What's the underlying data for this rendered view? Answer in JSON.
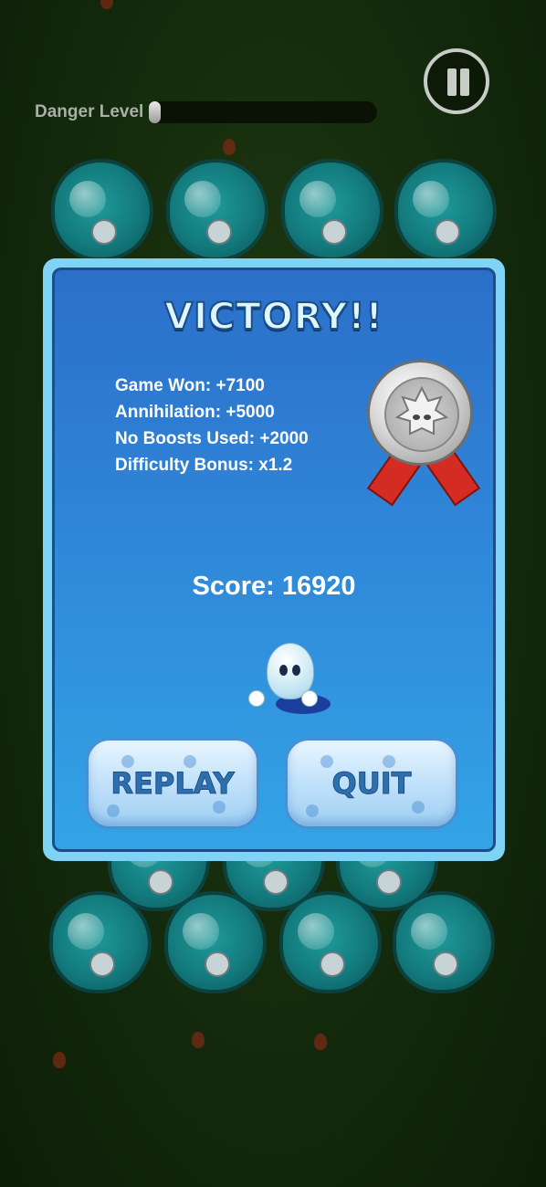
{
  "hud": {
    "danger_label": "Danger Level",
    "danger_level": 0.04
  },
  "dialog": {
    "title": "VICTORY!!",
    "bonuses": [
      "Game Won: +7100",
      "Annihilation: +5000",
      "No Boosts Used: +2000",
      "Difficulty Bonus: x1.2"
    ],
    "score_text": "Score: 16920",
    "replay_label": "REPLAY",
    "quit_label": "QUIT"
  },
  "colors": {
    "panel_border": "#7fd3f4",
    "panel_bg_top": "#2b6fc9",
    "panel_bg_bottom": "#33a4e6",
    "ribbon": "#d42c22",
    "blob": "#137a7d"
  },
  "icons": [
    "pause-icon",
    "silver-medal-icon",
    "mascot-character-icon",
    "slime-blob-icon"
  ]
}
